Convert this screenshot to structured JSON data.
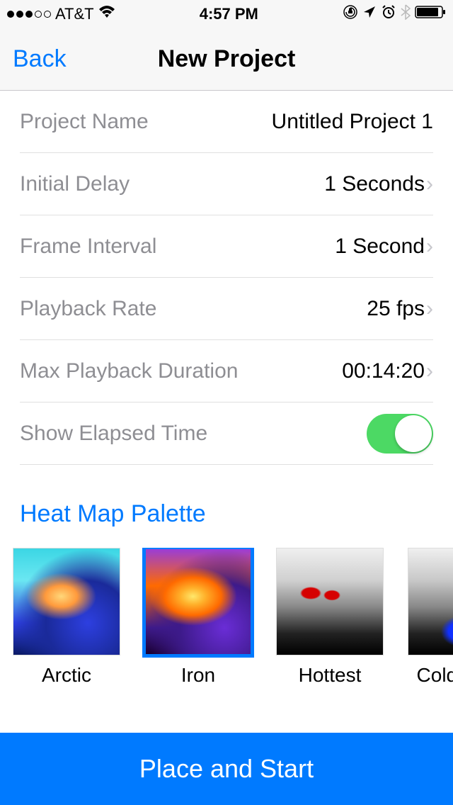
{
  "status": {
    "signal_dots_filled": 3,
    "carrier": "AT&T",
    "time": "4:57 PM"
  },
  "nav": {
    "back_label": "Back",
    "title": "New Project"
  },
  "settings": {
    "project_name_label": "Project Name",
    "project_name_value": "Untitled Project 1",
    "initial_delay_label": "Initial Delay",
    "initial_delay_value": "1 Seconds",
    "frame_interval_label": "Frame Interval",
    "frame_interval_value": "1 Second",
    "playback_rate_label": "Playback Rate",
    "playback_rate_value": "25 fps",
    "max_duration_label": "Max Playback Duration",
    "max_duration_value": "00:14:20",
    "show_elapsed_label": "Show Elapsed Time",
    "show_elapsed_on": true
  },
  "palette": {
    "section_title": "Heat Map Palette",
    "items": [
      {
        "label": "Arctic",
        "selected": false
      },
      {
        "label": "Iron",
        "selected": true
      },
      {
        "label": "Hottest",
        "selected": false
      },
      {
        "label": "Coldest",
        "selected": false
      }
    ]
  },
  "cta": {
    "label": "Place and Start"
  }
}
